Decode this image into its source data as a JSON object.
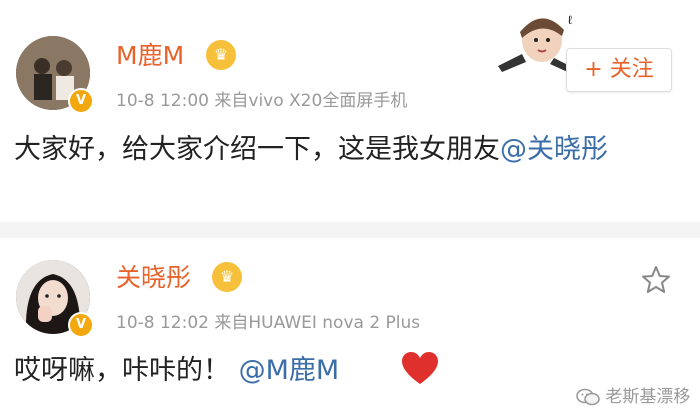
{
  "posts": [
    {
      "author": "M鹿M",
      "time": "10-8 12:00",
      "source": "来自vivo X20全面屏手机",
      "content_text": "大家好，给大家介绍一下，这是我女朋友",
      "content_mention": "@关晓彤",
      "follow_label": "+ 关注"
    },
    {
      "author": "关晓彤",
      "time": "10-8 12:02",
      "source": "来自HUAWEI nova 2 Plus",
      "content_text": "哎呀嘛，咔咔的！",
      "content_mention": "@M鹿M"
    }
  ],
  "watermark": "老斯基漂移",
  "colors": {
    "name": "#e8632b",
    "mention": "#3b6ea8",
    "badge": "#f2a80e",
    "heart": "#e0302e"
  }
}
